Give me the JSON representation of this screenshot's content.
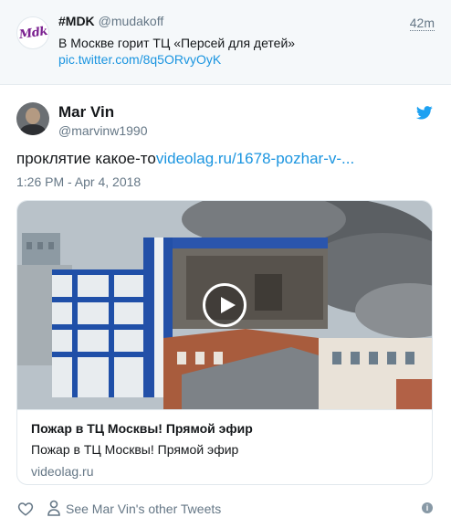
{
  "parent_tweet": {
    "avatar_text": "Mdk",
    "name": "#MDK",
    "handle": "@mudakoff",
    "time": "42m",
    "text": "В Москве горит ТЦ «Персей для детей»",
    "link": "pic.twitter.com/8q5ORvyOyK"
  },
  "tweet": {
    "author_name": "Mar Vin",
    "author_handle": "@marvinw1990",
    "text": "проклятие какое-то",
    "link": "videolag.ru/1678-pozhar-v-...",
    "date": "1:26 PM - Apr 4, 2018"
  },
  "card": {
    "title": "Пожар в ТЦ Москвы! Прямой эфир",
    "description": "Пожар в ТЦ Москвы! Прямой эфир",
    "domain": "videolag.ru"
  },
  "footer": {
    "other_tweets_label": "See Mar Vin's other Tweets",
    "info_label": "i"
  },
  "icons": {
    "bird": "twitter-bird-icon",
    "heart": "heart-icon",
    "person": "person-icon",
    "info": "info-icon",
    "play": "play-icon"
  },
  "colors": {
    "link": "#1b95e0",
    "secondary": "#657786",
    "bird": "#1da1f2",
    "parent_bg": "#f5f8fa"
  }
}
